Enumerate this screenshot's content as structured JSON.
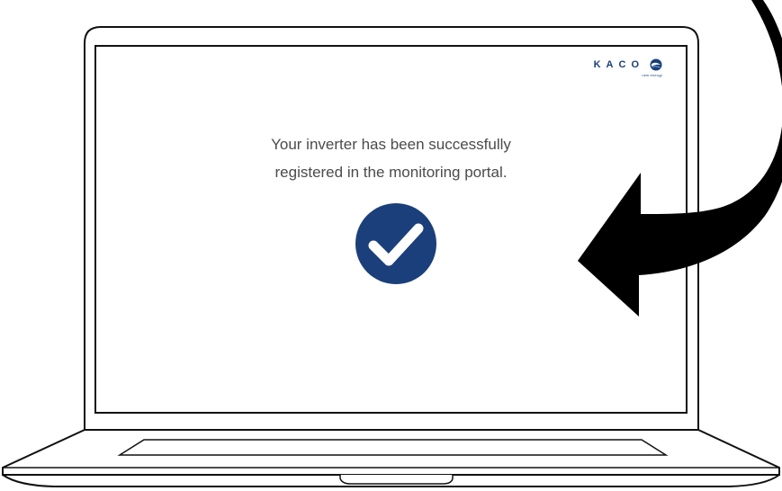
{
  "brand": {
    "wordmark": "KACO",
    "tagline": "new energy",
    "color": "#1b3f7a"
  },
  "message": {
    "line1": "Your inverter has been successfully",
    "line2": "registered in the monitoring portal."
  },
  "status": {
    "icon": "checkmark-circle-icon",
    "color": "#1b3f7a"
  },
  "pointer": {
    "icon": "curved-arrow-icon",
    "color": "#000000"
  }
}
